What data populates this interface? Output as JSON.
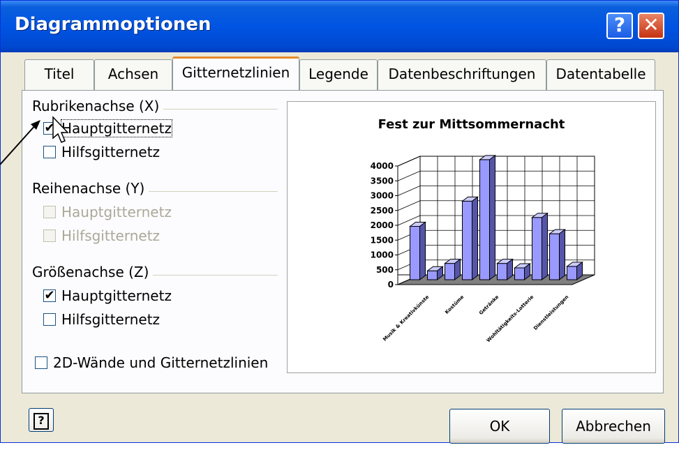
{
  "window": {
    "title": "Diagrammoptionen",
    "help_glyph": "?",
    "close_glyph": "✕"
  },
  "tabs": [
    {
      "label": "Titel"
    },
    {
      "label": "Achsen"
    },
    {
      "label": "Gitternetzlinien",
      "active": true
    },
    {
      "label": "Legende"
    },
    {
      "label": "Datenbeschriftungen"
    },
    {
      "label": "Datentabelle"
    }
  ],
  "groups": {
    "x": {
      "label": "Rubrikenachse (X)",
      "major": {
        "label": "Hauptgitternetz",
        "checked": true,
        "enabled": true
      },
      "minor": {
        "label": "Hilfsgitternetz",
        "checked": false,
        "enabled": true
      }
    },
    "y": {
      "label": "Reihenachse (Y)",
      "major": {
        "label": "Hauptgitternetz",
        "checked": false,
        "enabled": false
      },
      "minor": {
        "label": "Hilfsgitternetz",
        "checked": false,
        "enabled": false
      }
    },
    "z": {
      "label": "Größenachse (Z)",
      "major": {
        "label": "Hauptgitternetz",
        "checked": true,
        "enabled": true
      },
      "minor": {
        "label": "Hilfsgitternetz",
        "checked": false,
        "enabled": true
      }
    }
  },
  "walls_option": {
    "label": "2D-Wände und Gitternetzlinien",
    "checked": false
  },
  "check_glyph": "✔",
  "chart_data": {
    "type": "bar",
    "title": "Fest zur Mittsommernacht",
    "y_ticks": [
      "0",
      "500",
      "1000",
      "1500",
      "2000",
      "2500",
      "3000",
      "3500",
      "4000"
    ],
    "ylim": [
      0,
      4000
    ],
    "category_labels": [
      "Musik & Kreativkünste",
      "Kostüme",
      "Getränke",
      "Wohltätigkeits-Lotterie",
      "Dienstleistungen"
    ],
    "values": [
      1800,
      300,
      550,
      2650,
      4050,
      550,
      400,
      2100,
      1550,
      450
    ],
    "bar_color": "#9999ff"
  },
  "buttons": {
    "help": "?",
    "ok": "OK",
    "cancel": "Abbrechen"
  }
}
